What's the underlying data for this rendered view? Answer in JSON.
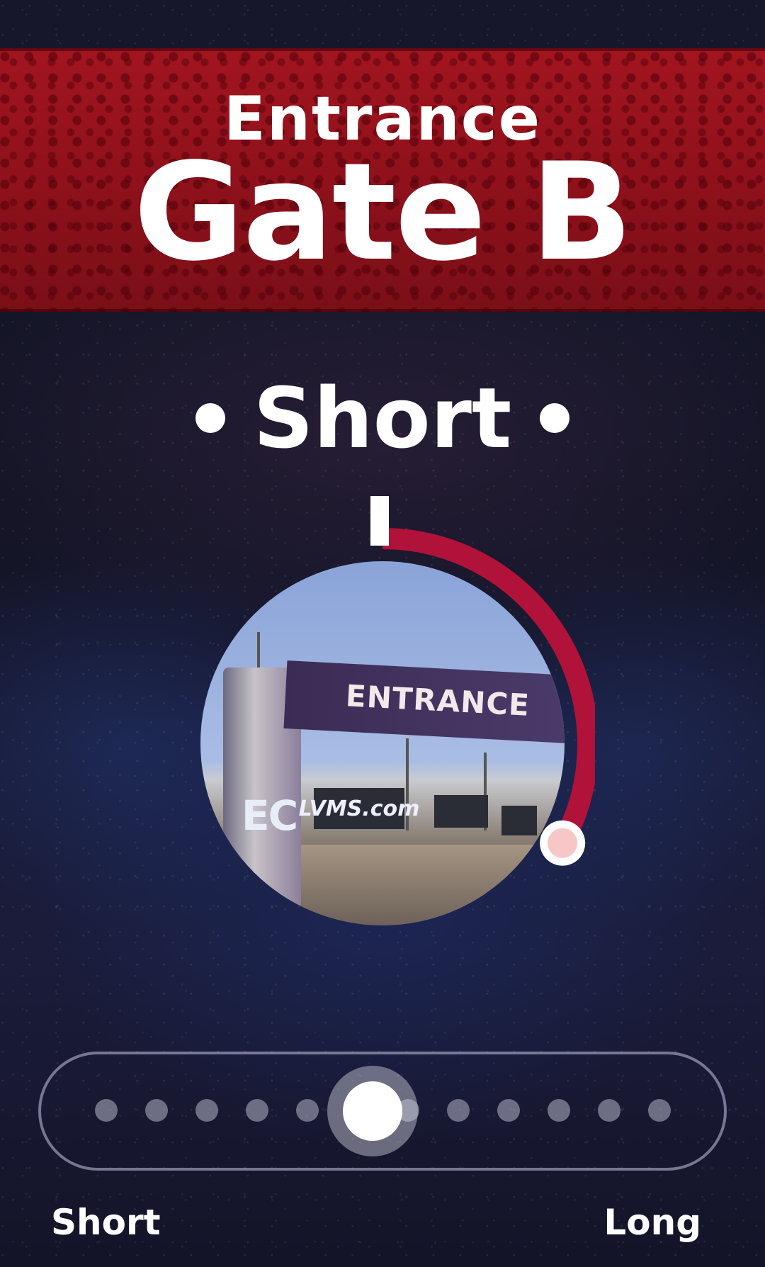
{
  "header": {
    "subtitle": "Entrance",
    "title": "Gate B"
  },
  "wait": {
    "label": "Short",
    "gauge_fraction": 0.33
  },
  "photo": {
    "sign_text": "ENTRANCE",
    "billboard_text": "LVMS.com",
    "tower_logo": "EC"
  },
  "slider": {
    "min_label": "Short",
    "max_label": "Long",
    "steps": 12,
    "selected_step": 6
  },
  "colors": {
    "banner": "#9a131d",
    "accent": "#b0123a",
    "knob": "#f7c6c6",
    "background": "#141428"
  }
}
